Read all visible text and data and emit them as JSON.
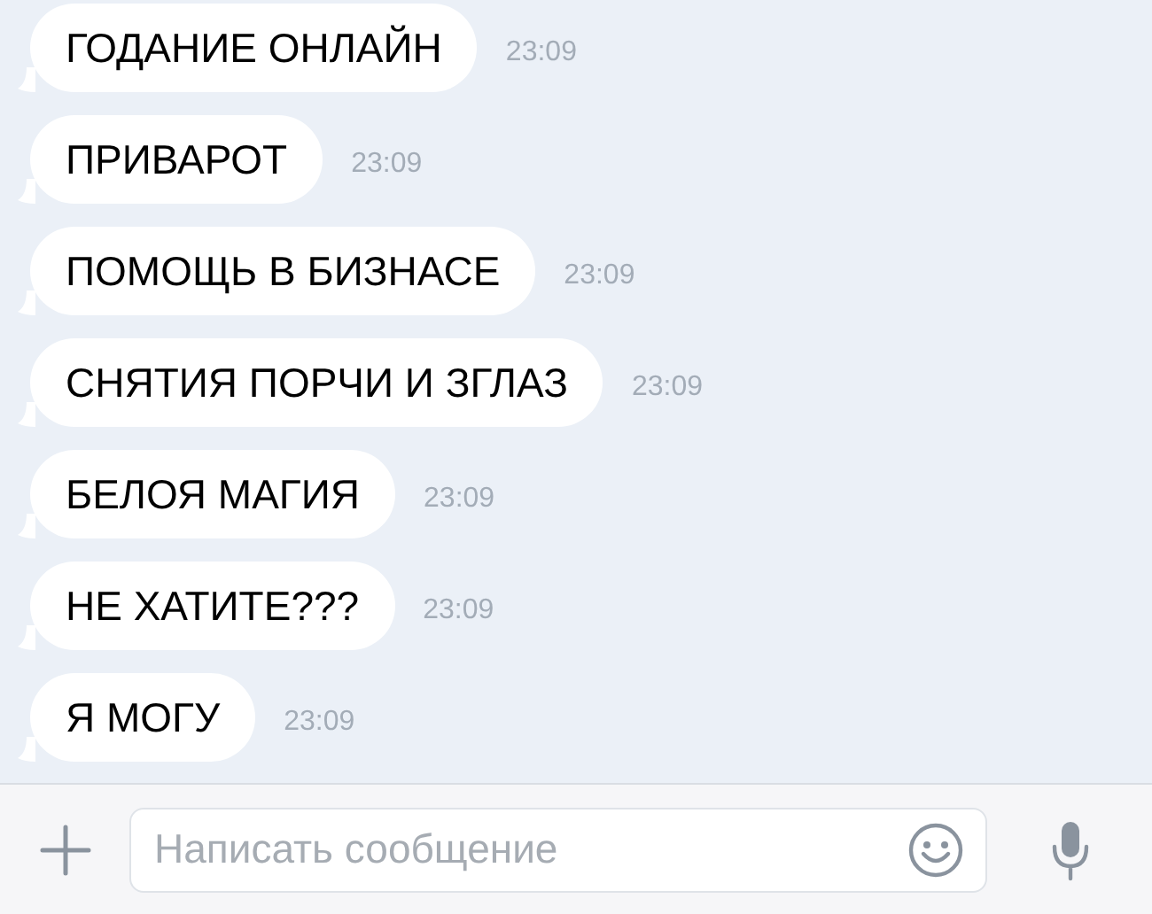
{
  "messages": [
    {
      "text": "ГОДАНИЕ ОНЛАЙН",
      "time": "23:09"
    },
    {
      "text": "ПРИВАРОТ",
      "time": "23:09"
    },
    {
      "text": "ПОМОЩЬ В БИЗНАСЕ",
      "time": "23:09"
    },
    {
      "text": "СНЯТИЯ ПОРЧИ И ЗГЛАЗ",
      "time": "23:09"
    },
    {
      "text": "БЕЛОЯ МАГИЯ",
      "time": "23:09"
    },
    {
      "text": "НЕ ХАТИТЕ???",
      "time": "23:09"
    },
    {
      "text": "Я МОГУ",
      "time": "23:09"
    }
  ],
  "composer": {
    "placeholder": "Написать сообщение"
  }
}
